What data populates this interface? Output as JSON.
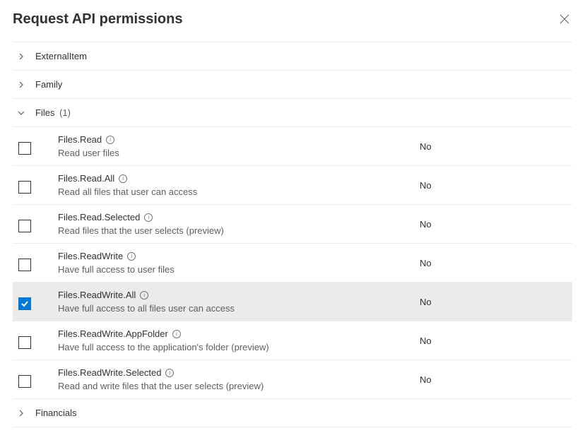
{
  "header": {
    "title": "Request API permissions"
  },
  "groups": [
    {
      "name": "ExternalItem",
      "expanded": false,
      "count": null
    },
    {
      "name": "Family",
      "expanded": false,
      "count": null
    },
    {
      "name": "Files",
      "expanded": true,
      "count": "(1)",
      "permissions": [
        {
          "name": "Files.Read",
          "desc": "Read user files",
          "admin": "No",
          "checked": false
        },
        {
          "name": "Files.Read.All",
          "desc": "Read all files that user can access",
          "admin": "No",
          "checked": false
        },
        {
          "name": "Files.Read.Selected",
          "desc": "Read files that the user selects (preview)",
          "admin": "No",
          "checked": false
        },
        {
          "name": "Files.ReadWrite",
          "desc": "Have full access to user files",
          "admin": "No",
          "checked": false
        },
        {
          "name": "Files.ReadWrite.All",
          "desc": "Have full access to all files user can access",
          "admin": "No",
          "checked": true
        },
        {
          "name": "Files.ReadWrite.AppFolder",
          "desc": "Have full access to the application's folder (preview)",
          "admin": "No",
          "checked": false
        },
        {
          "name": "Files.ReadWrite.Selected",
          "desc": "Read and write files that the user selects (preview)",
          "admin": "No",
          "checked": false
        }
      ]
    },
    {
      "name": "Financials",
      "expanded": false,
      "count": null
    }
  ]
}
